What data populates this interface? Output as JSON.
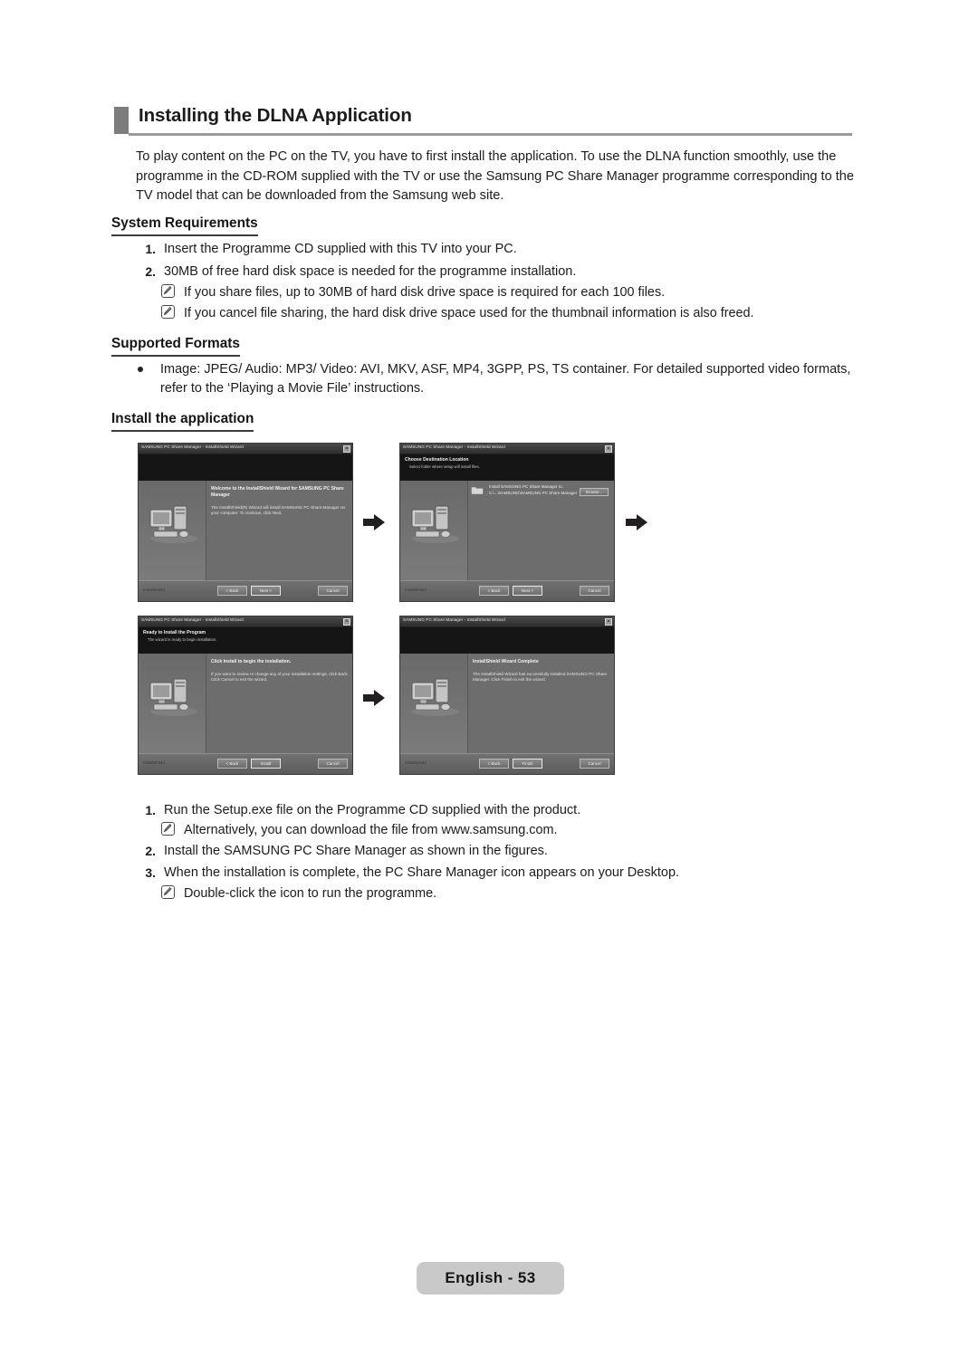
{
  "page": {
    "heading": "Installing the DLNA Application",
    "intro": "To play content on the PC on the TV, you have to first install the application. To use the DLNA function smoothly, use the programme in the CD-ROM supplied with the TV or use the Samsung PC Share Manager programme corresponding to the TV model that can be downloaded from the Samsung web site.",
    "footer": "English - 53"
  },
  "system_requirements": {
    "title": "System Requirements",
    "items": [
      {
        "num": "1.",
        "text": "Insert the Programme CD supplied with this TV into your PC."
      },
      {
        "num": "2.",
        "text": "30MB of free hard disk space is needed for the programme installation."
      }
    ],
    "notes": [
      "If you share files, up to 30MB of hard disk drive space is required for each 100 files.",
      "If you cancel file sharing, the hard disk drive space used for the thumbnail information is also freed."
    ]
  },
  "supported_formats": {
    "title": "Supported Formats",
    "bullet": "Image: JPEG/ Audio: MP3/ Video: AVI, MKV, ASF, MP4, 3GPP, PS, TS container. For detailed supported video formats, refer to the ‘Playing a Movie File’ instructions."
  },
  "install_the_application": {
    "title": "Install the application",
    "steps": [
      {
        "num": "1.",
        "text": "Run the Setup.exe file on the Programme CD supplied with the product."
      },
      {
        "num": "2.",
        "text": "Install the SAMSUNG PC Share Manager as shown in the figures."
      },
      {
        "num": "3.",
        "text": "When the installation is complete, the PC Share Manager icon appears on your Desktop."
      }
    ],
    "notes": [
      "Alternatively, you can download the file from www.samsung.com.",
      "Double-click the icon to run the programme."
    ]
  },
  "screenshots": [
    {
      "id": "welcome",
      "window_title": "SAMSUNG PC Share Manager - InstallShield Wizard",
      "banner_title": "",
      "banner_subtitle": "",
      "content_heading": "Welcome to the InstallShield Wizard for SAMSUNG PC Share Manager",
      "content_body": "The InstallShield(R) Wizard will install SAMSUNG PC Share Manager on your computer. To continue, click Next.",
      "installshield_label": "InstallShield",
      "buttons": {
        "back": "< Back",
        "next": "Next >",
        "cancel": "Cancel"
      }
    },
    {
      "id": "destination",
      "window_title": "SAMSUNG PC Share Manager - InstallShield Wizard",
      "banner_title": "Choose Destination Location",
      "banner_subtitle": "Select folder where setup will install files.",
      "dest_label": "Install SAMSUNG PC Share Manager to:",
      "dest_path": "C:\\...\\SAMSUNG\\SAMSUNG PC Share Manager",
      "browse_label": "Browse...",
      "installshield_label": "InstallShield",
      "buttons": {
        "back": "< Back",
        "next": "Next >",
        "cancel": "Cancel"
      }
    },
    {
      "id": "ready",
      "window_title": "SAMSUNG PC Share Manager - InstallShield Wizard",
      "banner_title": "Ready to Install the Program",
      "banner_subtitle": "The wizard is ready to begin installation.",
      "content_heading": "Click Install to begin the installation.",
      "content_body": "If you want to review or change any of your installation settings, click Back. Click Cancel to exit the wizard.",
      "installshield_label": "InstallShield",
      "buttons": {
        "back": "< Back",
        "next": "Install",
        "cancel": "Cancel"
      }
    },
    {
      "id": "complete",
      "window_title": "SAMSUNG PC Share Manager - InstallShield Wizard",
      "banner_title": "",
      "banner_subtitle": "",
      "content_heading": "InstallShield Wizard Complete",
      "content_body": "The InstallShield Wizard has successfully installed SAMSUNG PC Share Manager. Click Finish to exit the wizard.",
      "installshield_label": "InstallShield",
      "buttons": {
        "back": "< Back",
        "next": "Finish",
        "cancel": "Cancel"
      }
    }
  ]
}
